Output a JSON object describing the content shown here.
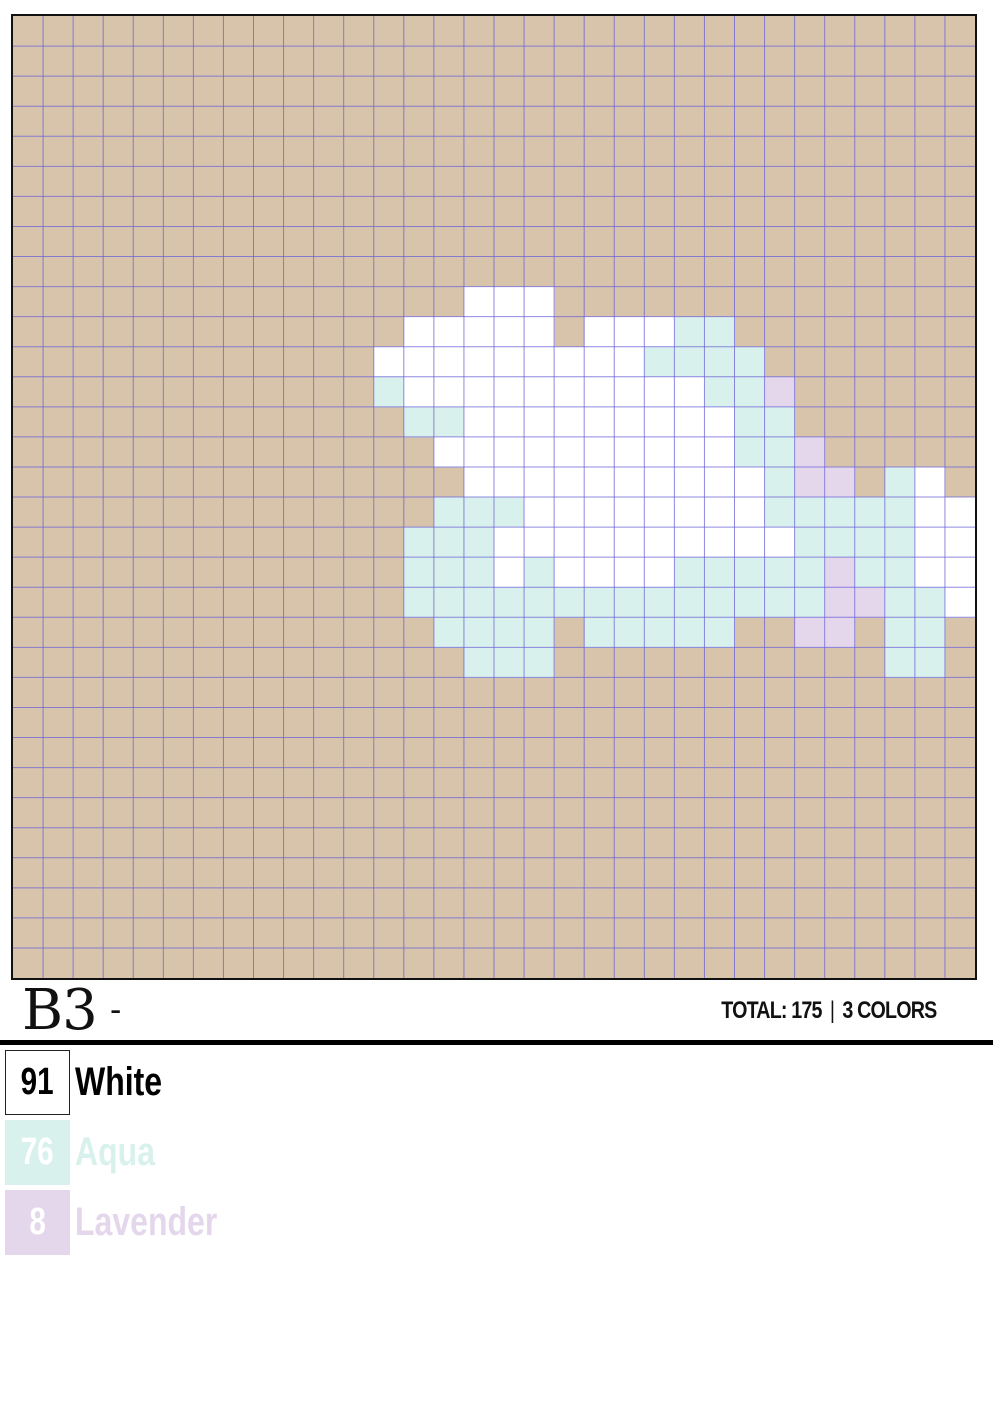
{
  "pattern": {
    "grid_cols": 32,
    "grid_rows": 32,
    "background_color": "#d8c4aa",
    "grid_line_color": "#6a62d8",
    "rows": [
      "................................",
      "................................",
      "................................",
      "................................",
      "................................",
      "................................",
      "................................",
      "................................",
      "................................",
      "...............WWW..............",
      ".............WWWWW.WWWAA........",
      "............WWWWWWWWWAAAA.......",
      "............AWWWWWWWWWWAAL......",
      ".............AAWWWWWWWWWAA......",
      "..............WWWWWWWWWWAAL.....",
      "...............WWWWWWWWWWALL.AW.",
      "..............AAAWWWWWWWWAAAAAWW",
      ".............AAAWWWWWWWWWWAAAAWW",
      ".............AAAWAWWWWAAAAALAAWW",
      ".............AAAAAAAAAAAAAALLAAW",
      "..............AAAA.AAAAA..LL.AA.",
      "...............AAA...........AA.",
      "................................",
      "................................",
      "................................",
      "................................",
      "................................",
      "................................",
      "................................",
      "................................",
      "................................",
      "................................"
    ]
  },
  "header": {
    "title": "B3",
    "dash": "-",
    "total": "TOTAL: 175",
    "separator": "|",
    "colors_count": "3 COLORS"
  },
  "legend": [
    {
      "code": "W",
      "count": "91",
      "name": "White",
      "color": "#ffffff",
      "text_color": "#000000",
      "outlined": true
    },
    {
      "code": "A",
      "count": "76",
      "name": "Aqua",
      "color": "#d9f1ec",
      "text_color": "#ffffff",
      "name_color": "#d9f1ec",
      "outlined": false
    },
    {
      "code": "L",
      "count": "8",
      "name": "Lavender",
      "color": "#e4d7ec",
      "text_color": "#ffffff",
      "name_color": "#e4d7ec",
      "outlined": false
    }
  ]
}
